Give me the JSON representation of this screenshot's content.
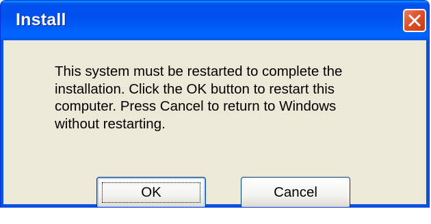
{
  "window": {
    "title": "Install",
    "close_icon": "close-icon",
    "accent_color": "#0054e3",
    "close_color": "#e0502b"
  },
  "message": {
    "text": "This system must be restarted to complete the\ninstallation. Click the OK button to restart this\ncomputer. Press Cancel to return to Windows\nwithout restarting."
  },
  "buttons": {
    "ok_label": "OK",
    "cancel_label": "Cancel"
  }
}
